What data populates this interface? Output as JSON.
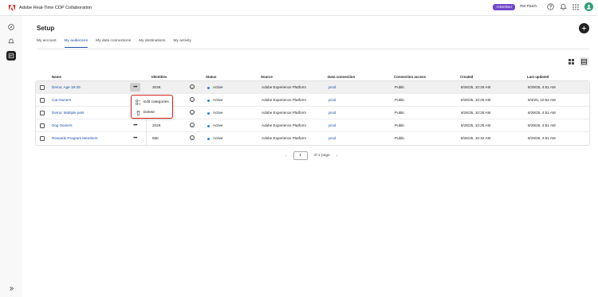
{
  "app": {
    "title": "Adobe Real-Time CDP Collaboration",
    "logo_icon": "adobe-logo-icon"
  },
  "topbar": {
    "role_badge": "Advertiser",
    "sandbox": "Pet Patch",
    "icons": [
      "help-icon",
      "bell-icon",
      "apps-grid-icon",
      "avatar"
    ]
  },
  "leftnav": {
    "items": [
      {
        "icon": "compass-icon",
        "active": false
      },
      {
        "icon": "bell-outline-icon",
        "active": false
      },
      {
        "icon": "setup-icon",
        "active": true
      }
    ],
    "expand_icon": "expand-chevrons-icon"
  },
  "page": {
    "title": "Setup"
  },
  "tabs": [
    {
      "label": "My account",
      "active": false
    },
    {
      "label": "My audiences",
      "active": true
    },
    {
      "label": "My data connections",
      "active": false
    },
    {
      "label": "My destinations",
      "active": false
    },
    {
      "label": "My activity",
      "active": false
    }
  ],
  "table": {
    "columns": [
      "Name",
      "Identities",
      "Status",
      "Source",
      "Data connection",
      "Connection access",
      "Created",
      "Last updated"
    ],
    "rows": [
      {
        "name": "Demo: Age 18-25",
        "identities": "203K",
        "status": "Active",
        "source": "Adobe Experience Platform",
        "connection": "prod",
        "access": "Public",
        "created": "8/26/25, 10:28 AM",
        "updated": "8/29/25, 4:51 AM"
      },
      {
        "name": "Cat Owners",
        "identities": "",
        "status": "Active",
        "source": "Adobe Experience Platform",
        "connection": "prod",
        "access": "Public",
        "created": "8/26/25, 10:28 AM",
        "updated": "9/3/25, 10:52 AM"
      },
      {
        "name": "Demo: Multiple pets",
        "identities": "",
        "status": "Active",
        "source": "Adobe Experience Platform",
        "connection": "prod",
        "access": "Public",
        "created": "8/26/25, 10:28 AM",
        "updated": "8/29/25, 4:51 AM"
      },
      {
        "name": "Dog Owners",
        "identities": "202K",
        "status": "Active",
        "source": "Adobe Experience Platform",
        "connection": "prod",
        "access": "Public",
        "created": "8/26/25, 10:28 AM",
        "updated": "8/29/25, 4:51 AM"
      },
      {
        "name": "Rewards Program Members",
        "identities": "55K",
        "status": "Active",
        "source": "Adobe Experience Platform",
        "connection": "prod",
        "access": "Public",
        "created": "8/26/25, 10:32 AM",
        "updated": "8/29/25, 4:51 AM"
      }
    ]
  },
  "context_menu": {
    "items": [
      {
        "label": "Edit categories",
        "icon": "edit-categories-icon"
      },
      {
        "label": "Delete",
        "icon": "trash-icon"
      }
    ]
  },
  "pagination": {
    "current_page": "1",
    "suffix": "of 1 page"
  },
  "colors": {
    "accent": "#1a4fa3",
    "badge": "#6e49cb",
    "highlight": "#d7261e",
    "status_dot": "#2680eb"
  }
}
